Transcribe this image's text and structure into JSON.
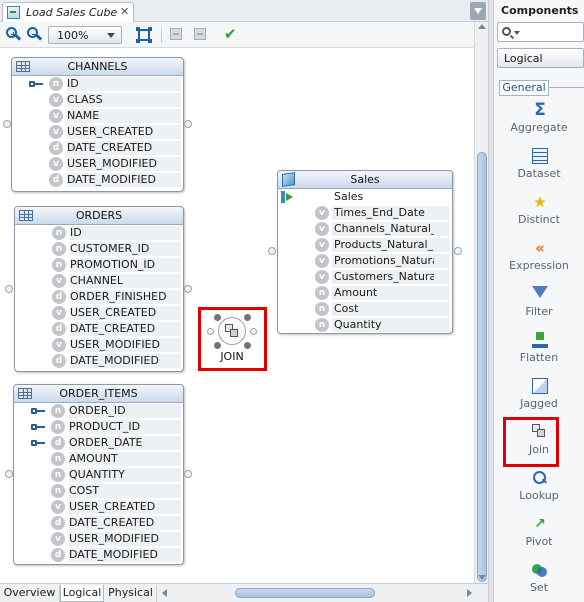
{
  "editor": {
    "tab_title": "Load Sales Cube",
    "zoom": "100%"
  },
  "entities": {
    "channels": {
      "title": "CHANNELS",
      "attributes": [
        {
          "name": "ID",
          "key": true,
          "type": "n"
        },
        {
          "name": "CLASS",
          "key": false,
          "type": "v"
        },
        {
          "name": "NAME",
          "key": false,
          "type": "v"
        },
        {
          "name": "USER_CREATED",
          "key": false,
          "type": "v"
        },
        {
          "name": "DATE_CREATED",
          "key": false,
          "type": "d"
        },
        {
          "name": "USER_MODIFIED",
          "key": false,
          "type": "v"
        },
        {
          "name": "DATE_MODIFIED",
          "key": false,
          "type": "d"
        }
      ]
    },
    "orders": {
      "title": "ORDERS",
      "attributes": [
        {
          "name": "ID",
          "key": false,
          "type": "n"
        },
        {
          "name": "CUSTOMER_ID",
          "key": false,
          "type": "n"
        },
        {
          "name": "PROMOTION_ID",
          "key": false,
          "type": "n"
        },
        {
          "name": "CHANNEL",
          "key": false,
          "type": "v"
        },
        {
          "name": "ORDER_FINISHED",
          "key": false,
          "type": "d"
        },
        {
          "name": "USER_CREATED",
          "key": false,
          "type": "v"
        },
        {
          "name": "DATE_CREATED",
          "key": false,
          "type": "d"
        },
        {
          "name": "USER_MODIFIED",
          "key": false,
          "type": "v"
        },
        {
          "name": "DATE_MODIFIED",
          "key": false,
          "type": "d"
        }
      ]
    },
    "order_items": {
      "title": "ORDER_ITEMS",
      "attributes": [
        {
          "name": "ORDER_ID",
          "key": true,
          "type": "n"
        },
        {
          "name": "PRODUCT_ID",
          "key": true,
          "type": "n"
        },
        {
          "name": "ORDER_DATE",
          "key": true,
          "type": "d"
        },
        {
          "name": "AMOUNT",
          "key": false,
          "type": "n"
        },
        {
          "name": "QUANTITY",
          "key": false,
          "type": "n"
        },
        {
          "name": "COST",
          "key": false,
          "type": "n"
        },
        {
          "name": "USER_CREATED",
          "key": false,
          "type": "v"
        },
        {
          "name": "DATE_CREATED",
          "key": false,
          "type": "d"
        },
        {
          "name": "USER_MODIFIED",
          "key": false,
          "type": "v"
        },
        {
          "name": "DATE_MODIFIED",
          "key": false,
          "type": "d"
        }
      ]
    },
    "sales": {
      "title": "Sales",
      "output_label": "Sales",
      "attributes": [
        {
          "name": "Times_End_Date",
          "type": "v"
        },
        {
          "name": "Channels_Natural_",
          "type": "v"
        },
        {
          "name": "Products_Natural_I",
          "type": "v"
        },
        {
          "name": "Promotions_Natura",
          "type": "v"
        },
        {
          "name": "Customers_Natura",
          "type": "v"
        },
        {
          "name": "Amount",
          "type": "n"
        },
        {
          "name": "Cost",
          "type": "n"
        },
        {
          "name": "Quantity",
          "type": "n"
        }
      ]
    }
  },
  "join_node": {
    "label": "JOIN"
  },
  "bottom_tabs": {
    "overview": "Overview",
    "logical": "Logical",
    "physical": "Physical"
  },
  "components": {
    "title": "Components",
    "category": "Logical",
    "section": "General",
    "items": [
      {
        "label": "Aggregate",
        "icon": "aggregate-icon"
      },
      {
        "label": "Dataset",
        "icon": "dataset-icon"
      },
      {
        "label": "Distinct",
        "icon": "distinct-icon"
      },
      {
        "label": "Expression",
        "icon": "expression-icon"
      },
      {
        "label": "Filter",
        "icon": "filter-icon"
      },
      {
        "label": "Flatten",
        "icon": "flatten-icon"
      },
      {
        "label": "Jagged",
        "icon": "jagged-icon"
      },
      {
        "label": "Join",
        "icon": "join-icon"
      },
      {
        "label": "Lookup",
        "icon": "lookup-icon"
      },
      {
        "label": "Pivot",
        "icon": "pivot-icon"
      },
      {
        "label": "Set",
        "icon": "set-icon"
      }
    ]
  },
  "colors": {
    "highlight": "#e00000",
    "entity_header": "#cbd9ea",
    "type_icon": "#c2c6ca"
  }
}
